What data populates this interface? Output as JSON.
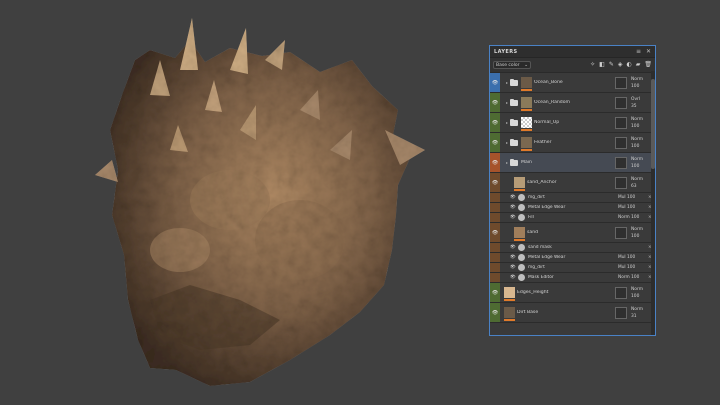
{
  "panel": {
    "title": "LAYERS",
    "channel": "Base color"
  },
  "layers": [
    {
      "name": "Ocean_Bone",
      "strip": "#3b6fad",
      "indent": 0,
      "type": "folder",
      "thumb": "#6b5a47",
      "blend": "Norm",
      "opacity": "100"
    },
    {
      "name": "Ocean_Random",
      "strip": "#4e6b32",
      "indent": 0,
      "type": "folder",
      "thumb": "#8a7a5a",
      "blend": "Ovrl",
      "opacity": "35"
    },
    {
      "name": "Normal_Up",
      "strip": "#4e6b32",
      "indent": 0,
      "type": "folder",
      "thumb": "checker",
      "blend": "Norm",
      "opacity": "100"
    },
    {
      "name": "Feather",
      "strip": "#4e6b32",
      "indent": 0,
      "type": "folder",
      "thumb": "#7a6850",
      "blend": "Norm",
      "opacity": "100"
    },
    {
      "name": "Main",
      "strip": "#a6532b",
      "indent": 0,
      "type": "folder",
      "thumb": "",
      "blend": "Norm",
      "opacity": "100"
    },
    {
      "name": "sand_Anchor",
      "strip": "#6e4a2c",
      "indent": 1,
      "type": "layer",
      "thumb": "#b69c77",
      "blend": "Norm",
      "opacity": "63"
    },
    {
      "name": "mg_dirt",
      "sub": true,
      "blend": "Mul",
      "opacity": "100"
    },
    {
      "name": "Metal Edge Wear",
      "sub": true,
      "blend": "Mul",
      "opacity": "100"
    },
    {
      "name": "Fill",
      "sub": true,
      "blend": "Norm",
      "opacity": "100"
    },
    {
      "name": "sand",
      "strip": "#6e4a2c",
      "indent": 1,
      "type": "layer",
      "thumb": "#a07e5b",
      "blend": "Norm",
      "opacity": "100"
    },
    {
      "name": "sand mask",
      "sub": true,
      "blend": "",
      "opacity": ""
    },
    {
      "name": "Metal Edge Wear",
      "sub": true,
      "blend": "Mul",
      "opacity": "100"
    },
    {
      "name": "mg_dirt",
      "sub": true,
      "blend": "Mul",
      "opacity": "100"
    },
    {
      "name": "Mask Editor",
      "sub": true,
      "blend": "Norm",
      "opacity": "100"
    },
    {
      "name": "Edges_Height",
      "strip": "#4e6b32",
      "indent": 0,
      "type": "layer",
      "thumb": "#d8b78f",
      "blend": "Norm",
      "opacity": "100"
    },
    {
      "name": "Dirt Base",
      "strip": "#4e6b32",
      "indent": 0,
      "type": "layer",
      "thumb": "#6a5a48",
      "blend": "Norm",
      "opacity": "31"
    }
  ],
  "icons": {
    "header": [
      "menu-icon",
      "close-icon"
    ],
    "toolbar": [
      "wand-icon",
      "fill-layer-icon",
      "paint-icon",
      "smart-material-icon",
      "mask-icon",
      "folder-icon",
      "trash-icon"
    ]
  },
  "colors": {
    "panel_border": "#4a82c6",
    "accent": "#e07a2a"
  }
}
